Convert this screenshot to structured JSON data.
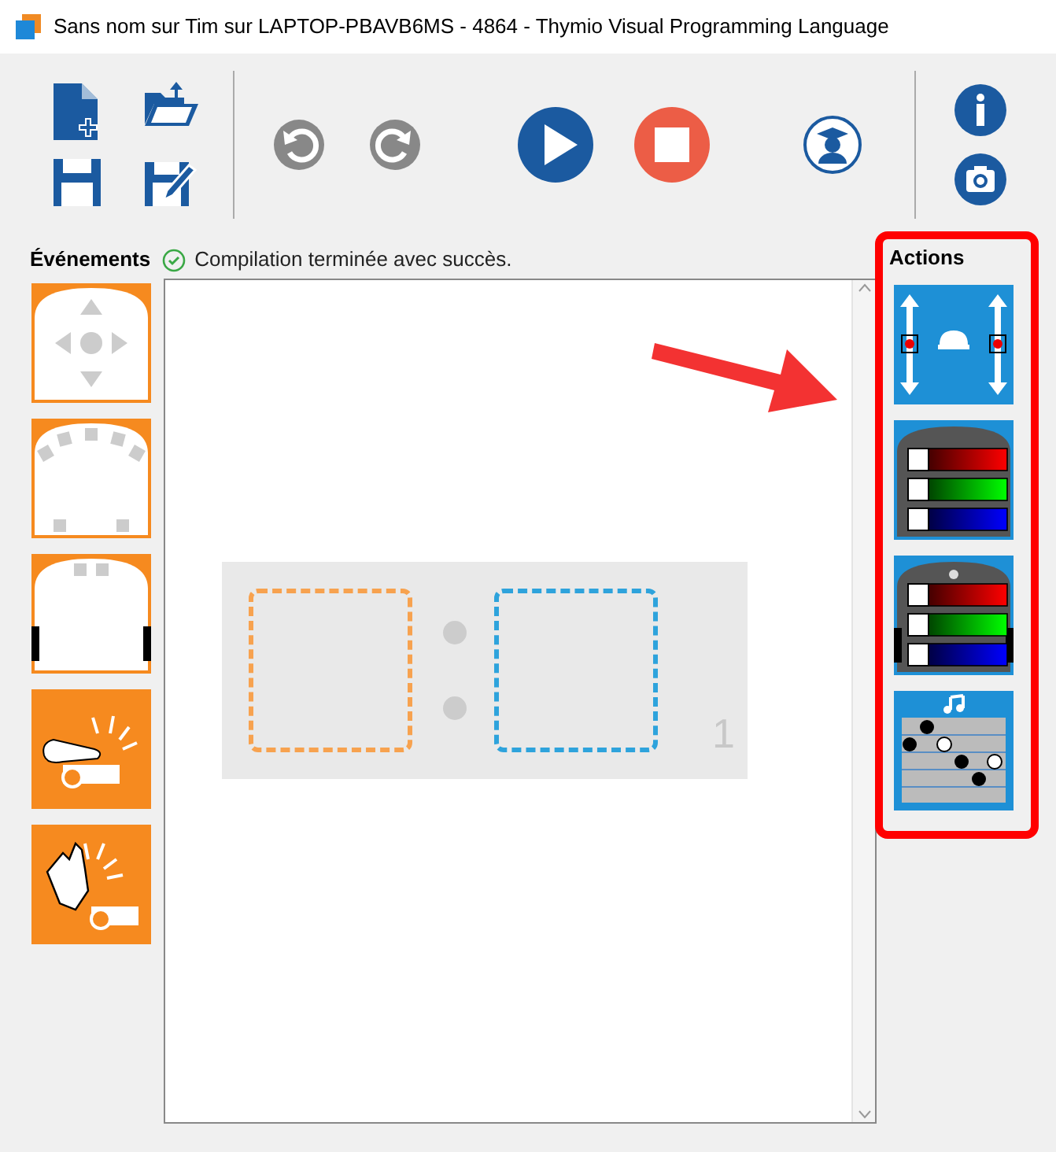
{
  "window": {
    "title": "Sans nom  sur Tim sur LAPTOP-PBAVB6MS - 4864 - Thymio Visual Programming Language"
  },
  "events": {
    "title": "Événements",
    "blocks": [
      {
        "kind": "buttons"
      },
      {
        "kind": "proximity"
      },
      {
        "kind": "ground"
      },
      {
        "kind": "tap"
      },
      {
        "kind": "clap"
      }
    ]
  },
  "status": {
    "text": "Compilation terminée avec succès.",
    "ok": true
  },
  "program": {
    "rows": [
      {
        "number": "1"
      }
    ]
  },
  "actions": {
    "title": "Actions",
    "blocks": [
      {
        "kind": "motors"
      },
      {
        "kind": "top_color"
      },
      {
        "kind": "bottom_color"
      },
      {
        "kind": "music"
      }
    ]
  }
}
